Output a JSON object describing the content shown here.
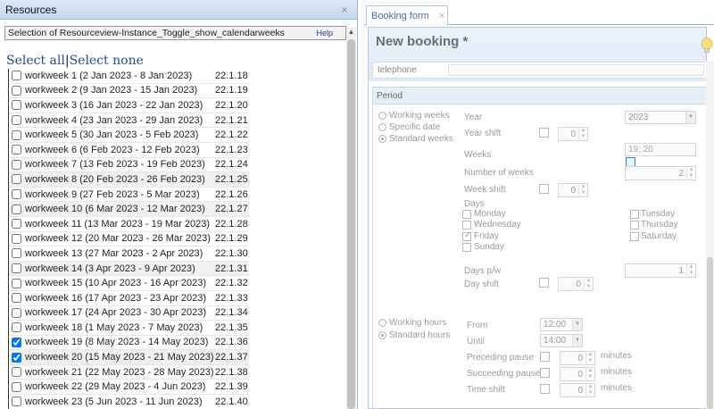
{
  "left": {
    "title": "Resources",
    "close": "×",
    "selection_text": "Selection of Resourceview-Instance_Toggle_show_calendarweeks",
    "help": "Help",
    "select_all": "Select all",
    "separator": "|",
    "select_none": "Select none",
    "weeks": [
      {
        "label": "workweek 1 (2 Jan 2023 - 8 Jan 2023)",
        "code": "22.1.18",
        "checked": false
      },
      {
        "label": "workweek 2 (9 Jan 2023 - 15 Jan 2023)",
        "code": "22.1.19",
        "checked": false
      },
      {
        "label": "workweek 3 (16 Jan 2023 - 22 Jan 2023)",
        "code": "22.1.20",
        "checked": false
      },
      {
        "label": "workweek 4 (23 Jan 2023 - 29 Jan 2023)",
        "code": "22.1.21",
        "checked": false
      },
      {
        "label": "workweek 5 (30 Jan 2023 - 5 Feb 2023)",
        "code": "22.1.22",
        "checked": false
      },
      {
        "label": "workweek 6 (6 Feb 2023 - 12 Feb 2023)",
        "code": "22.1.23",
        "checked": false
      },
      {
        "label": "workweek 7 (13 Feb 2023 - 19 Feb 2023)",
        "code": "22.1.24",
        "checked": false
      },
      {
        "label": "workweek 8 (20 Feb 2023 - 26 Feb 2023)",
        "code": "22.1.25",
        "checked": false
      },
      {
        "label": "workweek 9 (27 Feb 2023 - 5 Mar 2023)",
        "code": "22.1.26",
        "checked": false
      },
      {
        "label": "workweek 10 (6 Mar 2023 - 12 Mar 2023)",
        "code": "22.1.27",
        "checked": false
      },
      {
        "label": "workweek 11 (13 Mar 2023 - 19 Mar 2023)",
        "code": "22.1.28",
        "checked": false
      },
      {
        "label": "workweek 12 (20 Mar 2023 - 26 Mar 2023)",
        "code": "22.1.29",
        "checked": false
      },
      {
        "label": "workweek 13 (27 Mar 2023 - 2 Apr 2023)",
        "code": "22.1.30",
        "checked": false
      },
      {
        "label": "workweek 14 (3 Apr 2023 - 9 Apr 2023)",
        "code": "22.1.31",
        "checked": false
      },
      {
        "label": "workweek 15 (10 Apr 2023 - 16 Apr 2023)",
        "code": "22.1.32",
        "checked": false
      },
      {
        "label": "workweek 16 (17 Apr 2023 - 23 Apr 2023)",
        "code": "22.1.33",
        "checked": false
      },
      {
        "label": "workweek 17 (24 Apr 2023 - 30 Apr 2023)",
        "code": "22.1.34",
        "checked": false
      },
      {
        "label": "workweek 18 (1 May 2023 - 7 May 2023)",
        "code": "22.1.35",
        "checked": false
      },
      {
        "label": "workweek 19 (8 May 2023 - 14 May 2023)",
        "code": "22.1.36",
        "checked": true
      },
      {
        "label": "workweek 20 (15 May 2023 - 21 May 2023)",
        "code": "22.1.37",
        "checked": true
      },
      {
        "label": "workweek 21 (22 May 2023 - 28 May 2023)",
        "code": "22.1.38",
        "checked": false
      },
      {
        "label": "workweek 22 (29 May 2023 - 4 Jun 2023)",
        "code": "22.1.39",
        "checked": false
      },
      {
        "label": "workweek 23 (5 Jun 2023 - 11 Jun 2023)",
        "code": "22.1.40",
        "checked": false
      }
    ]
  },
  "right": {
    "tab_label": "Booking form",
    "tab_close": "×",
    "form_title": "New booking *",
    "telephone_label": "telephone",
    "period_label": "Period",
    "radio_working_weeks": "Working weeks",
    "radio_specific_date": "Specific date",
    "radio_standard_weeks": "Standard weeks",
    "year_label": "Year",
    "year_value": "2023",
    "year_shift_label": "Year shift",
    "year_shift_value": "0",
    "weeks_label": "Weeks",
    "weeks_value": "19; 20",
    "number_of_weeks_label": "Number of weeks",
    "number_of_weeks_value": "2",
    "week_shift_label": "Week shift",
    "week_shift_value": "0",
    "days_label": "Days",
    "day_monday": "Monday",
    "day_tuesday": "Tuesday",
    "day_wednesday": "Wednesday",
    "day_thursday": "Thursday",
    "day_friday": "Friday",
    "day_saturday": "Saturday",
    "day_sunday": "Sunday",
    "days_pw_label": "Days p/w",
    "days_pw_value": "1",
    "day_shift_label": "Day shift",
    "day_shift_value": "0",
    "radio_working_hours": "Working hours",
    "radio_standard_hours": "Standard hours",
    "from_label": "From",
    "from_value": "12:00",
    "until_label": "Until",
    "until_value": "14:00",
    "preceding_pause_label": "Preceding pause",
    "preceding_pause_value": "0",
    "succeeding_pause_label": "Succeeding pause",
    "succeeding_pause_value": "0",
    "time_shift_label": "Time shift",
    "time_shift_value": "0",
    "minutes": "minutes"
  }
}
